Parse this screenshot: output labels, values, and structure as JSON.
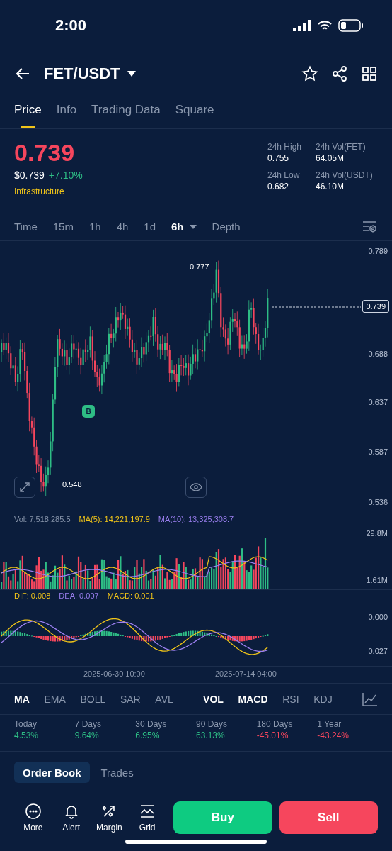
{
  "status_bar": {
    "time": "2:00"
  },
  "header": {
    "pair": "FET/USDT"
  },
  "tabs": [
    {
      "label": "Price",
      "selected": true
    },
    {
      "label": "Info",
      "selected": false
    },
    {
      "label": "Trading Data",
      "selected": false
    },
    {
      "label": "Square",
      "selected": false
    }
  ],
  "price": {
    "last": "0.739",
    "usd": "$0.739",
    "change": "+7.10%",
    "tag": "Infrastructure"
  },
  "stats": [
    {
      "label": "24h High",
      "value": "0.755"
    },
    {
      "label": "24h Vol(FET)",
      "value": "64.05M"
    },
    {
      "label": "24h Low",
      "value": "0.682"
    },
    {
      "label": "24h Vol(USDT)",
      "value": "46.10M"
    }
  ],
  "intervals": [
    {
      "label": "Time",
      "selected": false
    },
    {
      "label": "15m",
      "selected": false
    },
    {
      "label": "1h",
      "selected": false
    },
    {
      "label": "4h",
      "selected": false
    },
    {
      "label": "1d",
      "selected": false
    },
    {
      "label": "6h",
      "selected": true
    },
    {
      "label": "Depth",
      "selected": false
    }
  ],
  "chart": {
    "y_ticks": [
      "0.789",
      "0.688",
      "0.637",
      "0.587",
      "0.536"
    ],
    "high_label": "0.777",
    "low_label": "0.548",
    "current": "0.739",
    "marker": "B"
  },
  "volume": {
    "legend": [
      {
        "text": "Vol: 7,518,285.5",
        "color": "#8a97ad"
      },
      {
        "text": "MA(5): 14,221,197.9",
        "color": "#f0c419"
      },
      {
        "text": "MA(10): 13,325,308.7",
        "color": "#9b7ff0"
      }
    ],
    "y_ticks": [
      "29.8M",
      "1.61M"
    ]
  },
  "macd": {
    "legend": [
      {
        "text": "DIF: 0.008",
        "color": "#f0c419"
      },
      {
        "text": "DEA: 0.007",
        "color": "#9b7ff0"
      },
      {
        "text": "MACD: 0.001",
        "color": "#f0c419"
      }
    ],
    "y_ticks": [
      "0.000",
      "-0.027"
    ]
  },
  "dates": [
    "2025-06-30 10:00",
    "2025-07-14 04:00"
  ],
  "indicators": [
    {
      "label": "MA",
      "selected": true
    },
    {
      "label": "EMA",
      "selected": false
    },
    {
      "label": "BOLL",
      "selected": false
    },
    {
      "label": "SAR",
      "selected": false
    },
    {
      "label": "AVL",
      "selected": false
    },
    {
      "label": "VOL",
      "selected": true
    },
    {
      "label": "MACD",
      "selected": true
    },
    {
      "label": "RSI",
      "selected": false
    },
    {
      "label": "KDJ",
      "selected": false
    }
  ],
  "returns": [
    {
      "period": "Today",
      "value": "4.53%",
      "color": "#2ebd85"
    },
    {
      "period": "7 Days",
      "value": "9.64%",
      "color": "#2ebd85"
    },
    {
      "period": "30 Days",
      "value": "6.95%",
      "color": "#2ebd85"
    },
    {
      "period": "90 Days",
      "value": "63.13%",
      "color": "#2ebd85"
    },
    {
      "period": "180 Days",
      "value": "-45.01%",
      "color": "#f6465d"
    },
    {
      "period": "1 Year",
      "value": "-43.24%",
      "color": "#f6465d"
    }
  ],
  "book_tabs": [
    {
      "label": "Order Book",
      "selected": true
    },
    {
      "label": "Trades",
      "selected": false
    }
  ],
  "actions": [
    {
      "kind": "more",
      "label": "More"
    },
    {
      "kind": "alert",
      "label": "Alert"
    },
    {
      "kind": "margin",
      "label": "Margin"
    },
    {
      "kind": "grid",
      "label": "Grid"
    }
  ],
  "buttons": [
    {
      "kind": "buy",
      "label": "Buy"
    },
    {
      "kind": "sell",
      "label": "Sell"
    }
  ]
}
